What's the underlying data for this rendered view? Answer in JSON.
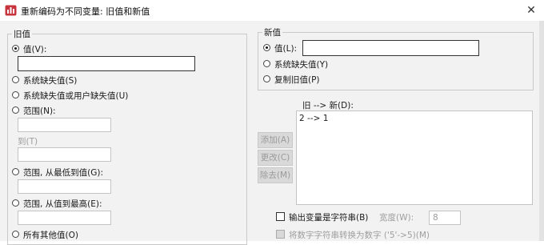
{
  "window": {
    "title": "重新编码为不同变量: 旧值和新值"
  },
  "old_value": {
    "group_label": "旧值",
    "value_label": "值(V):",
    "system_missing_label": "系统缺失值(S)",
    "system_or_user_missing_label": "系统缺失值或用户缺失值(U)",
    "range_label": "范围(N):",
    "through_label": "到(T)",
    "range_lowest_label": "范围, 从最低到值(G):",
    "range_highest_label": "范围, 从值到最高(E):",
    "all_other_label": "所有其他值(O)"
  },
  "new_value": {
    "group_label": "新值",
    "value_label": "值(L):",
    "system_missing_label": "系统缺失值(Y)",
    "copy_old_label": "复制旧值(P)"
  },
  "mapping": {
    "list_label": "旧 --> 新(D):",
    "items": [
      "2 --> 1"
    ],
    "add_label": "添加(A)",
    "change_label": "更改(C)",
    "remove_label": "除去(M)"
  },
  "options": {
    "output_string_label": "输出变量是字符串(B)",
    "width_label": "宽度(W):",
    "width_value": "8",
    "convert_numeric_label": "将数字字符串转换为数字 ('5'->5)(M)"
  }
}
